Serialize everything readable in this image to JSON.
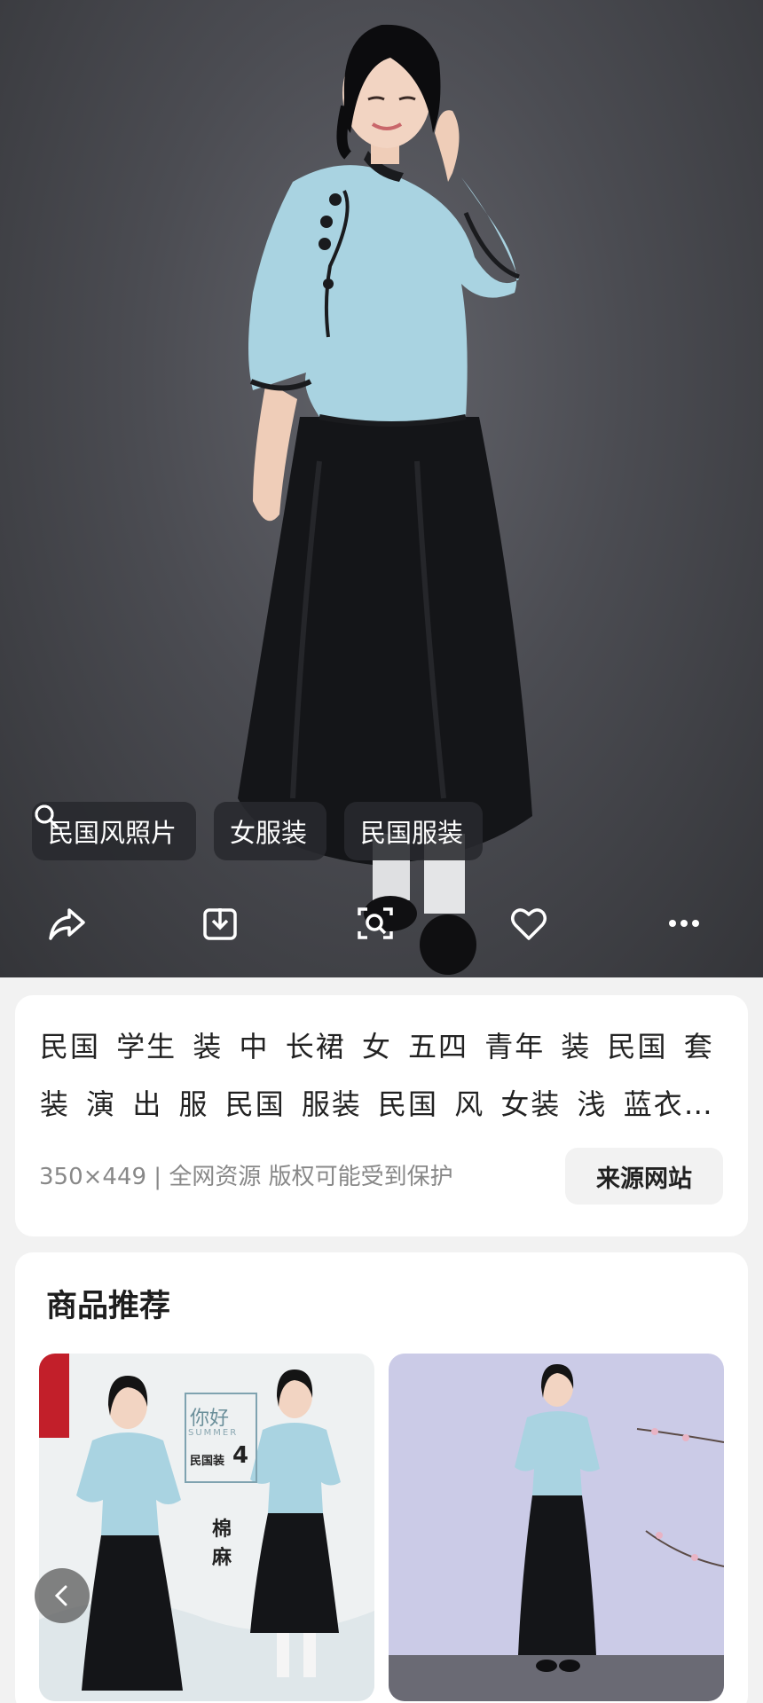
{
  "search_chips": [
    {
      "label": "民国风照片",
      "icon": "search-icon"
    },
    {
      "label": "女服装",
      "icon": "search-icon"
    },
    {
      "label": "民国服装",
      "icon": "search-icon"
    }
  ],
  "actions": [
    "share-icon",
    "download-icon",
    "visual-search-icon",
    "heart-icon",
    "more-icon"
  ],
  "image_info": {
    "title": "民国 学生 装 中 长裙 女 五四 青年 装 民国 套装 演 出 服 民国 服装 民国 风 女装  浅 蓝衣 + 黑 长裙 ...",
    "meta": "350×449 | 全网资源 版权可能受到保护",
    "source_button": "来源网站"
  },
  "recommendations": {
    "title": "商品推荐",
    "products": [
      {
        "overlay_texts": [
          "你好",
          "SUMMER",
          "民国装",
          "4",
          "棉",
          "麻"
        ]
      },
      {
        "overlay_texts": []
      }
    ],
    "prev_icon": "chevron-left-icon"
  },
  "colors": {
    "shirt_blue": "#a9d3e1",
    "skirt_black": "#141518",
    "chip_bg": "#28292d"
  }
}
